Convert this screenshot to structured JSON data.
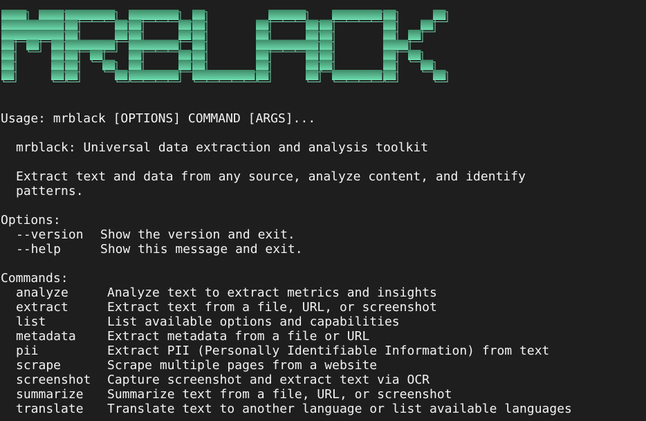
{
  "banner": {
    "text": "MRBLACK",
    "colors": {
      "top": "#3f8a68",
      "bottom": "#6fdcae",
      "outline": "#79d9b2"
    }
  },
  "usage": "Usage: mrblack [OPTIONS] COMMAND [ARGS]...",
  "description": "mrblack: Universal data extraction and analysis toolkit",
  "detail": [
    "Extract text and data from any source, analyze content, and identify",
    "patterns."
  ],
  "options_header": "Options:",
  "options": [
    {
      "name": "--version",
      "desc": "Show the version and exit."
    },
    {
      "name": "--help",
      "desc": "Show this message and exit."
    }
  ],
  "commands_header": "Commands:",
  "commands": [
    {
      "name": "analyze",
      "desc": "Analyze text to extract metrics and insights"
    },
    {
      "name": "extract",
      "desc": "Extract text from a file, URL, or screenshot"
    },
    {
      "name": "list",
      "desc": "List available options and capabilities"
    },
    {
      "name": "metadata",
      "desc": "Extract metadata from a file or URL"
    },
    {
      "name": "pii",
      "desc": "Extract PII (Personally Identifiable Information) from text"
    },
    {
      "name": "scrape",
      "desc": "Scrape multiple pages from a website"
    },
    {
      "name": "screenshot",
      "desc": "Capture screenshot and extract text via OCR"
    },
    {
      "name": "summarize",
      "desc": "Summarize text from a file, URL, or screenshot"
    },
    {
      "name": "translate",
      "desc": "Translate text to another language or list available languages"
    }
  ]
}
